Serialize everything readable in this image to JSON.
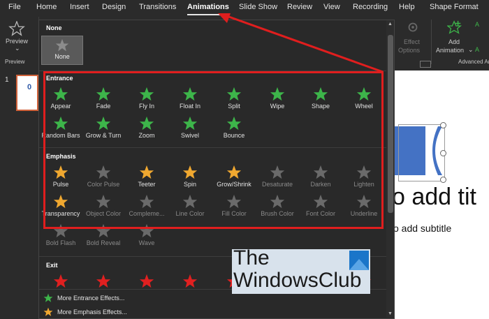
{
  "menu": {
    "tabs": [
      "File",
      "Home",
      "Insert",
      "Design",
      "Transitions",
      "Animations",
      "Slide Show",
      "Review",
      "View",
      "Recording",
      "Help",
      "Shape Format"
    ],
    "active": "Animations"
  },
  "ribbon": {
    "preview_label": "Preview",
    "preview_group": "Preview",
    "effect_options": [
      "Effect",
      "Options"
    ],
    "add_animation": [
      "Add",
      "Animation"
    ],
    "advanced_group": "Advanced Ani",
    "right_icons": [
      "A",
      "A"
    ]
  },
  "slides": {
    "thumb_number": "1",
    "thumb_text": "0",
    "title_placeholder": "o add tit",
    "subtitle_placeholder": "o add subtitle"
  },
  "gallery": {
    "none_section": "None",
    "none_item": "None",
    "entrance_section": "Entrance",
    "entrance": [
      "Appear",
      "Fade",
      "Fly In",
      "Float In",
      "Split",
      "Wipe",
      "Shape",
      "Wheel",
      "Random Bars",
      "Grow & Turn",
      "Zoom",
      "Swivel",
      "Bounce"
    ],
    "emphasis_section": "Emphasis",
    "emphasis_active": [
      "Pulse",
      "Teeter",
      "Spin",
      "Grow/Shrink",
      "Transparency"
    ],
    "emphasis": [
      "Pulse",
      "Color Pulse",
      "Teeter",
      "Spin",
      "Grow/Shrink",
      "Desaturate",
      "Darken",
      "Lighten",
      "Transparency",
      "Object Color",
      "Compleme...",
      "Line Color",
      "Fill Color",
      "Brush Color",
      "Font Color",
      "Underline",
      "Bold Flash",
      "Bold Reveal",
      "Wave"
    ],
    "exit_section": "Exit",
    "more_entrance": "More Entrance Effects...",
    "more_emphasis": "More Emphasis Effects..."
  },
  "watermark": {
    "line1": "The",
    "line2": "WindowsClub"
  },
  "colors": {
    "green_star": "#3db54a",
    "yellow_star": "#f0a830",
    "gray_star": "#8c8c8c",
    "red_star": "#e02020",
    "highlight": "#e01e1e"
  }
}
